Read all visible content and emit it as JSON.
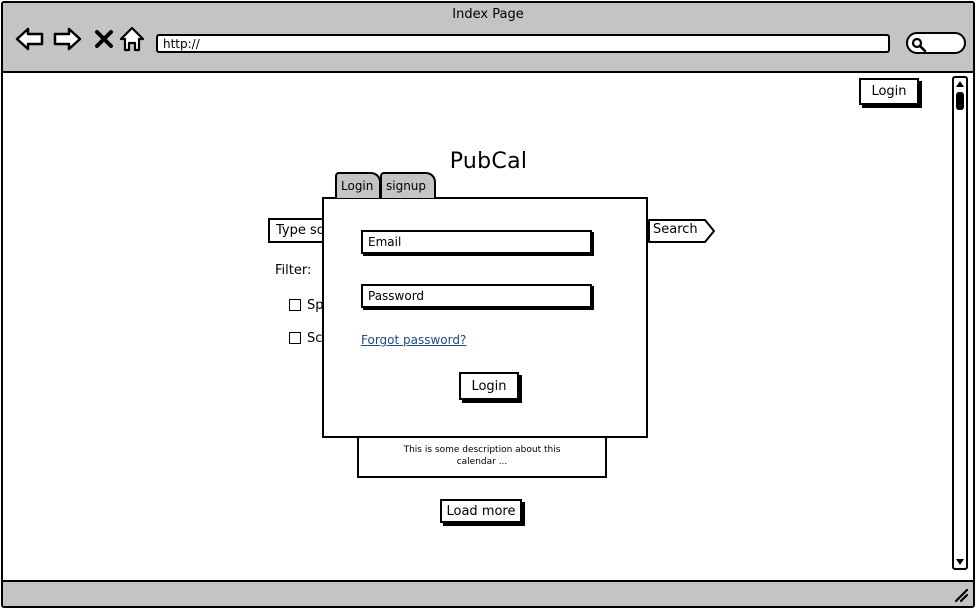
{
  "browser": {
    "title": "Index Page",
    "url": "http://"
  },
  "header": {
    "login_label": "Login"
  },
  "main": {
    "app_title": "PubCal",
    "search_placeholder": "Type so",
    "search_label": "Search",
    "filter_label": "Filter:",
    "filters": [
      {
        "label": "Sp"
      },
      {
        "label": "Sc"
      }
    ],
    "calendar_description": "This is some description about this calendar ...",
    "load_more_label": "Load more"
  },
  "dialog": {
    "tabs": [
      {
        "label": "Login"
      },
      {
        "label": "signup"
      }
    ],
    "email_placeholder": "Email",
    "password_placeholder": "Password",
    "forgot_password_label": "Forgot password?",
    "submit_label": "Login"
  },
  "icons": {
    "back": "back-arrow-icon",
    "forward": "forward-arrow-icon",
    "stop": "close-icon",
    "home": "home-icon",
    "search": "search-icon",
    "resize": "resize-grip-icon"
  },
  "colors": {
    "chrome": "#c4c4c4",
    "link": "#1f4a8a"
  }
}
